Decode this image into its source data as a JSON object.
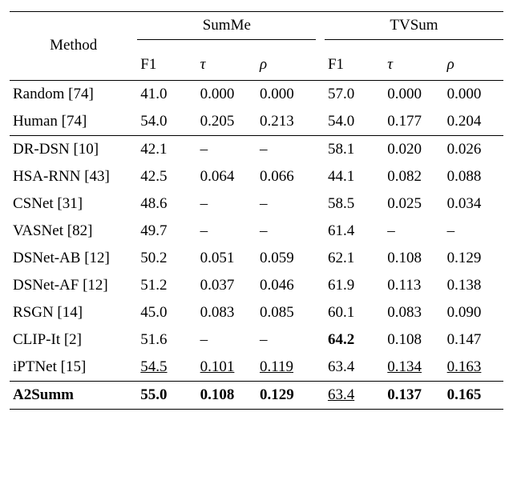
{
  "chart_data": {
    "type": "table",
    "title": "",
    "columns": [
      "Method",
      "SumMe F1",
      "SumMe τ",
      "SumMe ρ",
      "TVSum F1",
      "TVSum τ",
      "TVSum ρ"
    ],
    "rows": [
      [
        "Random [74]",
        41.0,
        0.0,
        0.0,
        57.0,
        0.0,
        0.0
      ],
      [
        "Human [74]",
        54.0,
        0.205,
        0.213,
        54.0,
        0.177,
        0.204
      ],
      [
        "DR-DSN [10]",
        42.1,
        null,
        null,
        58.1,
        0.02,
        0.026
      ],
      [
        "HSA-RNN [43]",
        42.5,
        0.064,
        0.066,
        44.1,
        0.082,
        0.088
      ],
      [
        "CSNet [31]",
        48.6,
        null,
        null,
        58.5,
        0.025,
        0.034
      ],
      [
        "VASNet [82]",
        49.7,
        null,
        null,
        61.4,
        null,
        null
      ],
      [
        "DSNet-AB [12]",
        50.2,
        0.051,
        0.059,
        62.1,
        0.108,
        0.129
      ],
      [
        "DSNet-AF [12]",
        51.2,
        0.037,
        0.046,
        61.9,
        0.113,
        0.138
      ],
      [
        "RSGN [14]",
        45.0,
        0.083,
        0.085,
        60.1,
        0.083,
        0.09
      ],
      [
        "CLIP-It [2]",
        51.6,
        null,
        null,
        64.2,
        0.108,
        0.147
      ],
      [
        "iPTNet [15]",
        54.5,
        0.101,
        0.119,
        63.4,
        0.134,
        0.163
      ],
      [
        "A2Summ",
        55.0,
        0.108,
        0.129,
        63.4,
        0.137,
        0.165
      ]
    ]
  },
  "headers": {
    "method": "Method",
    "group1": "SumMe",
    "group2": "TVSum",
    "f1": "F1",
    "tau": "τ",
    "rho": "ρ"
  },
  "rows": {
    "r0": {
      "method": "Random [74]",
      "s_f1": "41.0",
      "s_tau": "0.000",
      "s_rho": "0.000",
      "t_f1": "57.0",
      "t_tau": "0.000",
      "t_rho": "0.000"
    },
    "r1": {
      "method": "Human [74]",
      "s_f1": "54.0",
      "s_tau": "0.205",
      "s_rho": "0.213",
      "t_f1": "54.0",
      "t_tau": "0.177",
      "t_rho": "0.204"
    },
    "r2": {
      "method": "DR-DSN [10]",
      "s_f1": "42.1",
      "s_tau": "–",
      "s_rho": "–",
      "t_f1": "58.1",
      "t_tau": "0.020",
      "t_rho": "0.026"
    },
    "r3": {
      "method": "HSA-RNN [43]",
      "s_f1": "42.5",
      "s_tau": "0.064",
      "s_rho": "0.066",
      "t_f1": "44.1",
      "t_tau": "0.082",
      "t_rho": "0.088"
    },
    "r4": {
      "method": "CSNet [31]",
      "s_f1": "48.6",
      "s_tau": "–",
      "s_rho": "–",
      "t_f1": "58.5",
      "t_tau": "0.025",
      "t_rho": "0.034"
    },
    "r5": {
      "method": "VASNet [82]",
      "s_f1": "49.7",
      "s_tau": "–",
      "s_rho": "–",
      "t_f1": "61.4",
      "t_tau": "–",
      "t_rho": "–"
    },
    "r6": {
      "method": "DSNet-AB [12]",
      "s_f1": "50.2",
      "s_tau": "0.051",
      "s_rho": "0.059",
      "t_f1": "62.1",
      "t_tau": "0.108",
      "t_rho": "0.129"
    },
    "r7": {
      "method": "DSNet-AF [12]",
      "s_f1": "51.2",
      "s_tau": "0.037",
      "s_rho": "0.046",
      "t_f1": "61.9",
      "t_tau": "0.113",
      "t_rho": "0.138"
    },
    "r8": {
      "method": "RSGN [14]",
      "s_f1": "45.0",
      "s_tau": "0.083",
      "s_rho": "0.085",
      "t_f1": "60.1",
      "t_tau": "0.083",
      "t_rho": "0.090"
    },
    "r9": {
      "method": "CLIP-It [2]",
      "s_f1": "51.6",
      "s_tau": "–",
      "s_rho": "–",
      "t_f1": "64.2",
      "t_tau": "0.108",
      "t_rho": "0.147"
    },
    "r10": {
      "method": "iPTNet [15]",
      "s_f1": "54.5",
      "s_tau": "0.101",
      "s_rho": "0.119",
      "t_f1": "63.4",
      "t_tau": "0.134",
      "t_rho": "0.163"
    },
    "r11": {
      "method": "A2Summ",
      "s_f1": "55.0",
      "s_tau": "0.108",
      "s_rho": "0.129",
      "t_f1": "63.4",
      "t_tau": "0.137",
      "t_rho": "0.165"
    }
  }
}
